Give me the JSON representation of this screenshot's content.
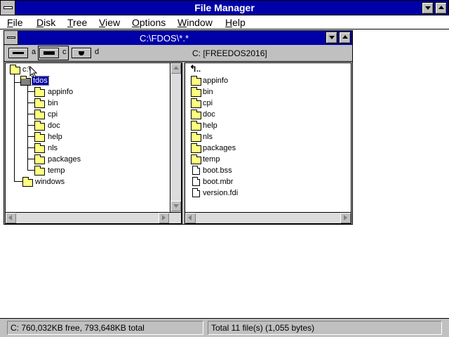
{
  "app": {
    "title": "File Manager"
  },
  "menu": [
    {
      "label": "File",
      "u": "F",
      "rest": "ile"
    },
    {
      "label": "Disk",
      "u": "D",
      "rest": "isk"
    },
    {
      "label": "Tree",
      "u": "T",
      "rest": "ree"
    },
    {
      "label": "View",
      "u": "V",
      "rest": "iew"
    },
    {
      "label": "Options",
      "u": "O",
      "rest": "ptions"
    },
    {
      "label": "Window",
      "u": "W",
      "rest": "indow"
    },
    {
      "label": "Help",
      "u": "H",
      "rest": "elp"
    }
  ],
  "child_window": {
    "title": "C:\\FDOS\\*.*",
    "volume_label": "C: [FREEDOS2016]",
    "drives": [
      {
        "letter": "a",
        "type": "floppy",
        "selected": false
      },
      {
        "letter": "c",
        "type": "hard-disk",
        "selected": true
      },
      {
        "letter": "d",
        "type": "cdrom",
        "selected": false
      }
    ]
  },
  "tree": {
    "root": "c:\\",
    "items": [
      {
        "label": "fdos",
        "level": 1,
        "open": true,
        "selected": true
      },
      {
        "label": "appinfo",
        "level": 2
      },
      {
        "label": "bin",
        "level": 2
      },
      {
        "label": "cpi",
        "level": 2
      },
      {
        "label": "doc",
        "level": 2
      },
      {
        "label": "help",
        "level": 2
      },
      {
        "label": "nls",
        "level": 2
      },
      {
        "label": "packages",
        "level": 2
      },
      {
        "label": "temp",
        "level": 2
      },
      {
        "label": "windows",
        "level": 1
      }
    ]
  },
  "files": {
    "up_label": "..",
    "items": [
      {
        "label": "appinfo",
        "kind": "folder"
      },
      {
        "label": "bin",
        "kind": "folder"
      },
      {
        "label": "cpi",
        "kind": "folder"
      },
      {
        "label": "doc",
        "kind": "folder"
      },
      {
        "label": "help",
        "kind": "folder"
      },
      {
        "label": "nls",
        "kind": "folder"
      },
      {
        "label": "packages",
        "kind": "folder"
      },
      {
        "label": "temp",
        "kind": "folder"
      },
      {
        "label": "boot.bss",
        "kind": "file"
      },
      {
        "label": "boot.mbr",
        "kind": "file"
      },
      {
        "label": "version.fdi",
        "kind": "file"
      }
    ]
  },
  "status": {
    "disk_free": "C: 760,032KB free,  793,648KB total",
    "file_total": "Total 11 file(s) (1,055 bytes)"
  },
  "colors": {
    "titlebar": "#0000a8",
    "chrome": "#c0c0c0",
    "folder": "#ffff80"
  }
}
